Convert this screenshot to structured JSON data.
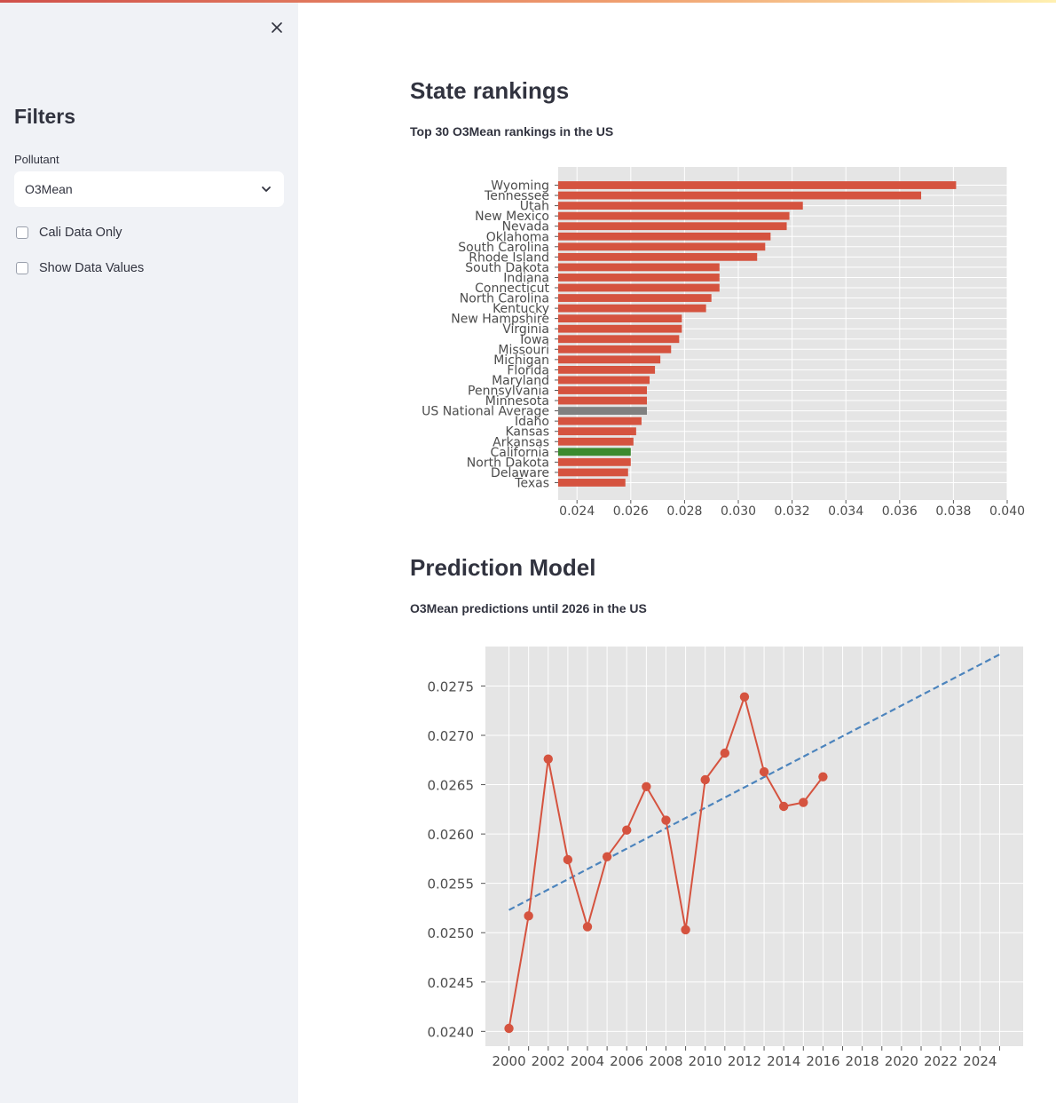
{
  "sidebar": {
    "title": "Filters",
    "pollutant_label": "Pollutant",
    "pollutant_value": "O3Mean",
    "checkboxes": [
      {
        "label": "Cali Data Only",
        "checked": false
      },
      {
        "label": "Show Data Values",
        "checked": false
      }
    ]
  },
  "icons": {
    "close": "close-icon",
    "dropdown": "chevron-down-icon"
  },
  "main": {
    "rankings_title": "State rankings",
    "rankings_caption": "Top 30 O3Mean rankings in the US",
    "prediction_title": "Prediction Model",
    "prediction_caption": "O3Mean predictions until 2026 in the US"
  },
  "chart_data": [
    {
      "type": "bar",
      "orientation": "horizontal",
      "categories": [
        "Wyoming",
        "Tennessee",
        "Utah",
        "New Mexico",
        "Nevada",
        "Oklahoma",
        "South Carolina",
        "Rhode Island",
        "South Dakota",
        "Indiana",
        "Connecticut",
        "North Carolina",
        "Kentucky",
        "New Hampshire",
        "Virginia",
        "Iowa",
        "Missouri",
        "Michigan",
        "Florida",
        "Maryland",
        "Pennsylvania",
        "Minnesota",
        "US National Average",
        "Idaho",
        "Kansas",
        "Arkansas",
        "California",
        "North Dakota",
        "Delaware",
        "Texas"
      ],
      "values": [
        0.0381,
        0.0368,
        0.0324,
        0.0319,
        0.0318,
        0.0312,
        0.031,
        0.0307,
        0.0293,
        0.0293,
        0.0293,
        0.029,
        0.0288,
        0.0279,
        0.0279,
        0.0278,
        0.0275,
        0.0271,
        0.0269,
        0.0267,
        0.0266,
        0.0266,
        0.0266,
        0.0264,
        0.0262,
        0.0261,
        0.026,
        0.026,
        0.0259,
        0.0258
      ],
      "colors": {
        "default": "#d5533f",
        "US National Average": "#808080",
        "California": "#3b8a2e"
      },
      "xlim": [
        0.0233,
        0.04
      ],
      "xticks": [
        "0.024",
        "0.026",
        "0.028",
        "0.030",
        "0.032",
        "0.034",
        "0.036",
        "0.038",
        "0.040"
      ],
      "grid": true
    },
    {
      "type": "line",
      "series": [
        {
          "x": [
            2000,
            2001,
            2002,
            2003,
            2004,
            2005,
            2006,
            2007,
            2008,
            2009,
            2010,
            2011,
            2012,
            2013,
            2014,
            2015,
            2016
          ],
          "values": [
            0.02403,
            0.02517,
            0.02676,
            0.02574,
            0.02506,
            0.02577,
            0.02604,
            0.02648,
            0.02614,
            0.02503,
            0.02655,
            0.02682,
            0.02739,
            0.02663,
            0.02628,
            0.02632,
            0.02658
          ],
          "color": "#d5533f",
          "style": "solid-markers"
        },
        {
          "x": [
            2000,
            2025
          ],
          "values": [
            0.02523,
            0.02782
          ],
          "color": "#4c84bd",
          "style": "dashed"
        }
      ],
      "xticks": [
        "2000",
        "2002",
        "2004",
        "2006",
        "2008",
        "2010",
        "2012",
        "2014",
        "2016",
        "2018",
        "2020",
        "2022",
        "2024"
      ],
      "yticks": [
        "0.0240",
        "0.0245",
        "0.0250",
        "0.0255",
        "0.0260",
        "0.0265",
        "0.0270",
        "0.0275"
      ],
      "xlim": [
        1998.8,
        2026.2
      ],
      "ylim": [
        0.02385,
        0.0279
      ],
      "grid": true
    }
  ]
}
